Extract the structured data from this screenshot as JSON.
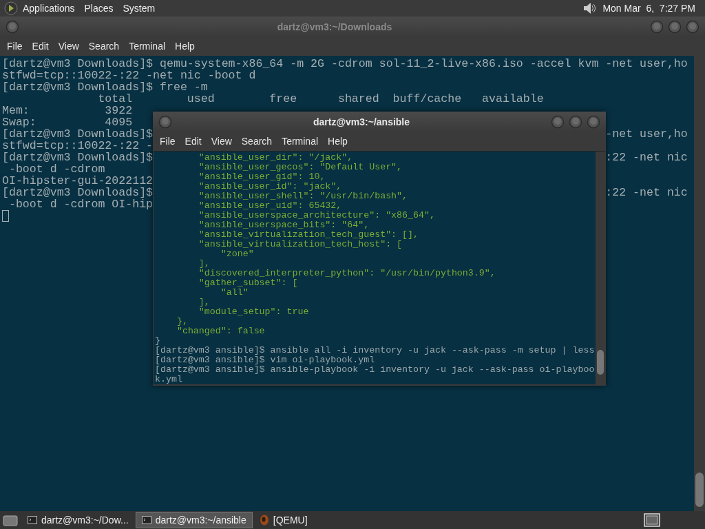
{
  "top_panel": {
    "menus": [
      "Applications",
      "Places",
      "System"
    ],
    "clock": "Mon Mar  6,  7:27 PM"
  },
  "background_terminal": {
    "title": "dartz@vm3:~/Downloads",
    "menu": [
      "File",
      "Edit",
      "View",
      "Search",
      "Terminal",
      "Help"
    ],
    "lines": [
      {
        "left": "[dartz@vm3 Downloads]$ qemu-system-x86_64 -m 2G -cdrom sol-11_2-live-x86.iso -accel kvm -net user,ho"
      },
      {
        "left": "stfwd=tcp::10022-:22 -net nic -boot d"
      },
      {
        "left": "[dartz@vm3 Downloads]$ free -m"
      },
      {
        "left": "              total        used        free      shared  buff/cache   available"
      },
      {
        "left": "Mem:           3922"
      },
      {
        "left": "Swap:          4095"
      },
      {
        "left": "[dartz@vm3 Downloads]$",
        "right": "-net user,ho"
      },
      {
        "left": "stfwd=tcp::10022-:22 -"
      },
      {
        "left": "[dartz@vm3 Downloads]$",
        "right": ":22 -net nic"
      },
      {
        "left": " -boot d -cdrom"
      },
      {
        "left": "OI-hipster-gui-2022112"
      },
      {
        "left": "[dartz@vm3 Downloads]$",
        "right": ":22 -net nic"
      },
      {
        "left": " -boot d -cdrom OI-hip"
      }
    ]
  },
  "front_terminal": {
    "title": "dartz@vm3:~/ansible",
    "menu": [
      "File",
      "Edit",
      "View",
      "Search",
      "Terminal",
      "Help"
    ],
    "lines": [
      {
        "kind": "output",
        "text": "        \"ansible_user_dir\": \"/jack\","
      },
      {
        "kind": "output",
        "text": "        \"ansible_user_gecos\": \"Default User\","
      },
      {
        "kind": "output",
        "text": "        \"ansible_user_gid\": 10,"
      },
      {
        "kind": "output",
        "text": "        \"ansible_user_id\": \"jack\","
      },
      {
        "kind": "output",
        "text": "        \"ansible_user_shell\": \"/usr/bin/bash\","
      },
      {
        "kind": "output",
        "text": "        \"ansible_user_uid\": 65432,"
      },
      {
        "kind": "output",
        "text": "        \"ansible_userspace_architecture\": \"x86_64\","
      },
      {
        "kind": "output",
        "text": "        \"ansible_userspace_bits\": \"64\","
      },
      {
        "kind": "output",
        "text": "        \"ansible_virtualization_tech_guest\": [],"
      },
      {
        "kind": "output",
        "text": "        \"ansible_virtualization_tech_host\": ["
      },
      {
        "kind": "output",
        "text": "            \"zone\""
      },
      {
        "kind": "output",
        "text": "        ],"
      },
      {
        "kind": "output",
        "text": "        \"discovered_interpreter_python\": \"/usr/bin/python3.9\","
      },
      {
        "kind": "output",
        "text": "        \"gather_subset\": ["
      },
      {
        "kind": "output",
        "text": "            \"all\""
      },
      {
        "kind": "output",
        "text": "        ],"
      },
      {
        "kind": "output",
        "text": "        \"module_setup\": true"
      },
      {
        "kind": "output",
        "text": "    },"
      },
      {
        "kind": "output",
        "text": "    \"changed\": false"
      },
      {
        "kind": "prompt",
        "text": "}"
      },
      {
        "kind": "prompt",
        "text": "[dartz@vm3 ansible]$ ansible all -i inventory -u jack --ask-pass -m setup | less"
      },
      {
        "kind": "prompt",
        "text": "[dartz@vm3 ansible]$ vim oi-playbook.yml"
      },
      {
        "kind": "prompt",
        "text": "[dartz@vm3 ansible]$ ansible-playbook -i inventory -u jack --ask-pass oi-playboo"
      },
      {
        "kind": "prompt",
        "text": "k.yml"
      }
    ]
  },
  "taskbar": {
    "items": [
      {
        "kind": "terminal",
        "label": "dartz@vm3:~/Dow...",
        "selected": false
      },
      {
        "kind": "terminal",
        "label": "dartz@vm3:~/ansible",
        "selected": true
      },
      {
        "kind": "qemu",
        "label": "[QEMU]",
        "selected": false
      }
    ]
  }
}
